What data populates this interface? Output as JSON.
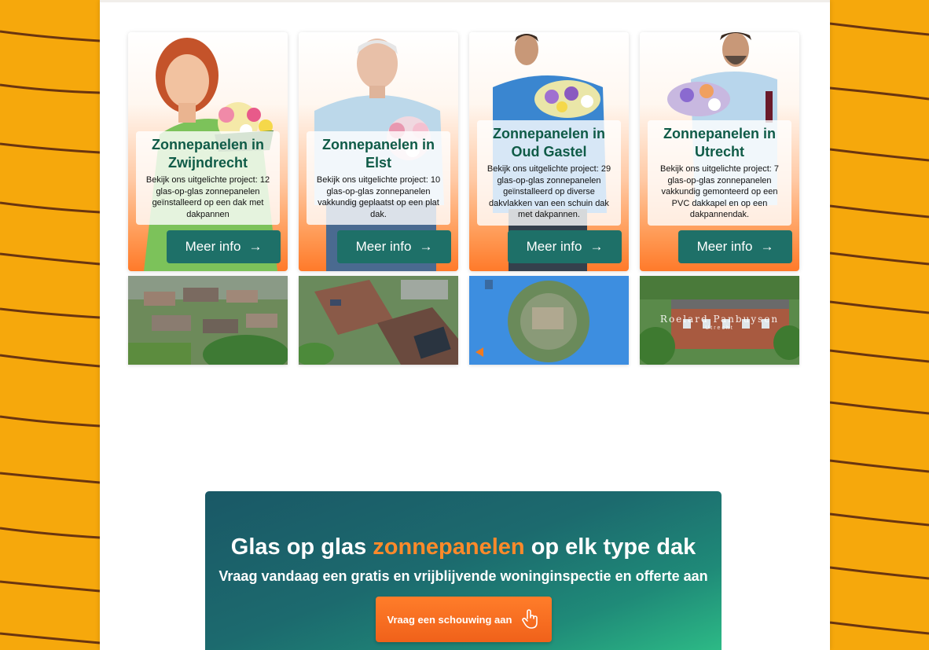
{
  "projects": [
    {
      "title": "Zonnepanelen in Zwijndrecht",
      "description": "Bekijk ons uitgelichte project: 12 glas-op-glas zonnepanelen geïnstalleerd op een dak met dakpannen",
      "button_label": "Meer info"
    },
    {
      "title": "Zonnepanelen in Elst",
      "description": "Bekijk ons uitgelichte project: 10 glas-op-glas zonnepanelen vakkundig geplaatst op een plat dak.",
      "button_label": "Meer info"
    },
    {
      "title": "Zonnepanelen in Oud Gastel",
      "description": "Bekijk ons uitgelichte project: 29 glas-op-glas zonnepanelen geïnstalleerd op diverse dakvlakken van een schuin dak met dakpannen.",
      "button_label": "Meer info"
    },
    {
      "title": "Zonnepanelen in Utrecht",
      "description": "Bekijk ons uitgelichte project: 7 glas-op-glas zonnepanelen vakkundig gemonteerd op een PVC dakkapel en op een dakpannendak.",
      "button_label": "Meer info"
    }
  ],
  "photo_overlay": {
    "name": "Roelard Panbuysen",
    "city": "Utrecht"
  },
  "cta": {
    "title_part1": "Glas op glas ",
    "title_accent": "zonnepanelen",
    "title_part2": " op elk type dak",
    "subtitle": "Vraag vandaag een gratis en vrijblijvende woninginspectie en offerte aan",
    "button_label": "Vraag een schouwing aan"
  },
  "icons": {
    "card_button": "arrow-right-icon",
    "cta_button": "pointer-hand-icon"
  },
  "colors": {
    "background": "#f6a80c",
    "card_title": "#0f5b47",
    "card_button": "#1e7068",
    "cta_accent": "#ff8a2a",
    "cta_button": "#f0611a"
  }
}
